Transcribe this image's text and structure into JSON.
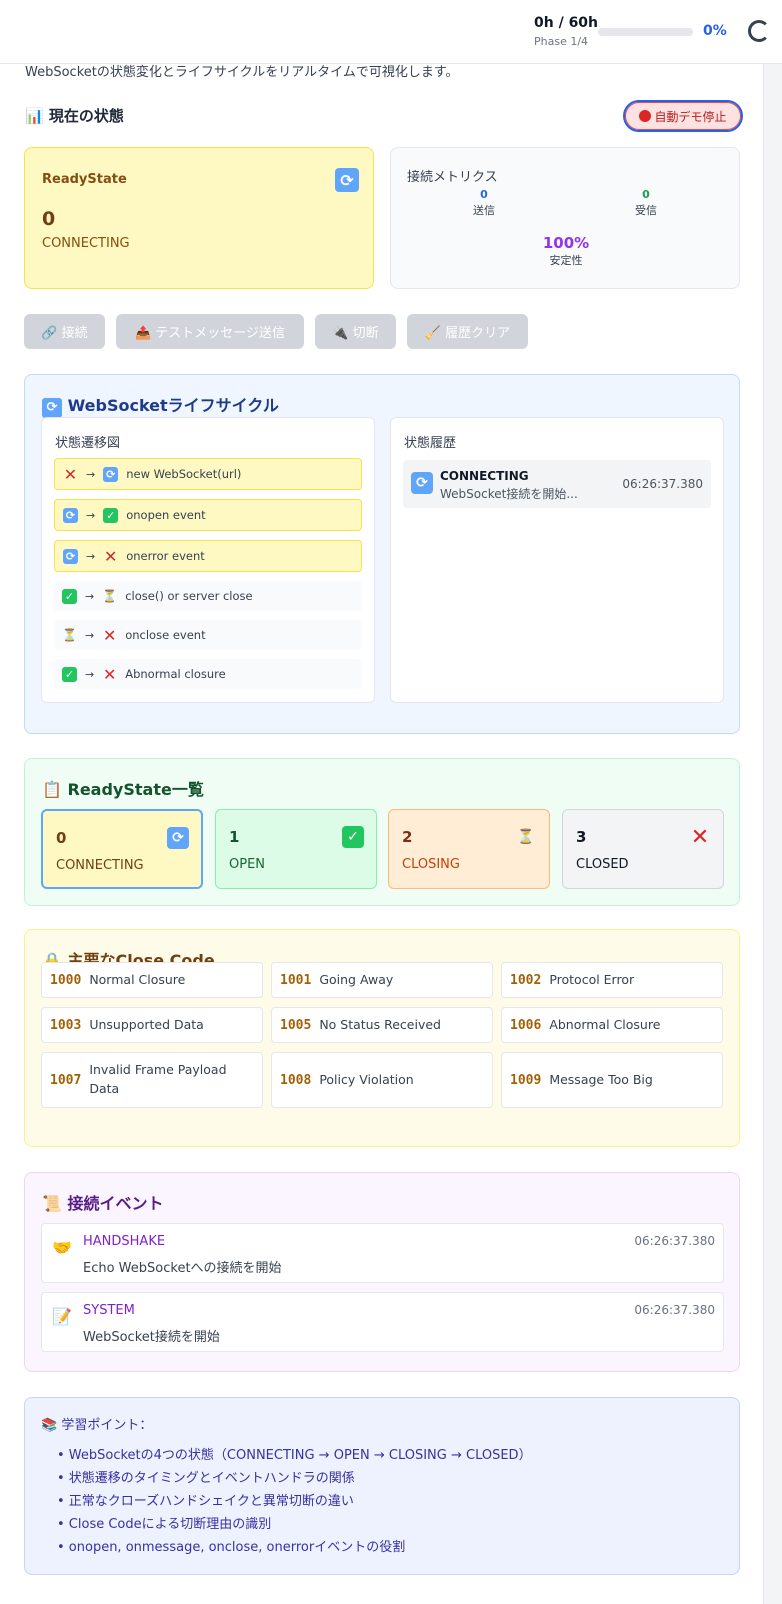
{
  "header": {
    "time": "0h / 60h",
    "phase": "Phase 1/4",
    "progress_percent": 0,
    "progress_label": "0%",
    "github_icon": "github-icon"
  },
  "intro_text": "WebSocketの状態変化とライフサイクルをリアルタイムで可視化します。",
  "current_state": {
    "title_icon": "📊",
    "title": "現在の状態",
    "stop_button": "自動デモ停止",
    "readystate_label": "ReadyState",
    "readystate_value": "0",
    "readystate_name": "CONNECTING",
    "readystate_icon": "sync-icon"
  },
  "metrics": {
    "title": "接続メトリクス",
    "sent_value": "0",
    "sent_label": "送信",
    "received_value": "0",
    "received_label": "受信",
    "stability_value": "100%",
    "stability_label": "安定性"
  },
  "actions": {
    "connect": "🔗 接続",
    "send_test": "📤 テストメッセージ送信",
    "disconnect": "🔌 切断",
    "clear_history": "🧹 履歴クリア"
  },
  "lifecycle": {
    "title": "WebSocketライフサイクル",
    "diagram_title": "状態遷移図",
    "transitions": [
      {
        "from": "x",
        "to": "sync",
        "label": "new WebSocket(url)",
        "highlight": true
      },
      {
        "from": "sync",
        "to": "ok",
        "label": "onopen event",
        "highlight": true
      },
      {
        "from": "sync",
        "to": "x",
        "label": "onerror event",
        "highlight": true
      },
      {
        "from": "ok",
        "to": "hourglass",
        "label": "close() or server close",
        "highlight": false
      },
      {
        "from": "hourglass",
        "to": "x",
        "label": "onclose event",
        "highlight": false
      },
      {
        "from": "ok",
        "to": "x",
        "label": "Abnormal closure",
        "highlight": false
      }
    ],
    "arrow": "→",
    "history_title": "状態履歴",
    "history": [
      {
        "state": "CONNECTING",
        "desc": "WebSocket接続を開始...",
        "time": "06:26:37.380"
      }
    ]
  },
  "readystate_list": {
    "title": "ReadyState一覧",
    "title_icon": "📋",
    "states": [
      {
        "num": "0",
        "name": "CONNECTING",
        "icon": "🔄"
      },
      {
        "num": "1",
        "name": "OPEN",
        "icon": "✓"
      },
      {
        "num": "2",
        "name": "CLOSING",
        "icon": "⏳"
      },
      {
        "num": "3",
        "name": "CLOSED",
        "icon": "✕"
      }
    ]
  },
  "close_codes": {
    "title": "主要なClose Code",
    "title_icon": "🔒",
    "codes": [
      {
        "code": "1000",
        "desc": "Normal Closure"
      },
      {
        "code": "1001",
        "desc": "Going Away"
      },
      {
        "code": "1002",
        "desc": "Protocol Error"
      },
      {
        "code": "1003",
        "desc": "Unsupported Data"
      },
      {
        "code": "1005",
        "desc": "No Status Received"
      },
      {
        "code": "1006",
        "desc": "Abnormal Closure"
      },
      {
        "code": "1007",
        "desc": "Invalid Frame Payload Data"
      },
      {
        "code": "1008",
        "desc": "Policy Violation"
      },
      {
        "code": "1009",
        "desc": "Message Too Big"
      }
    ]
  },
  "events": {
    "title": "接続イベント",
    "title_icon": "📜",
    "items": [
      {
        "icon": "🤝",
        "type": "HANDSHAKE",
        "message": "Echo WebSocketへの接続を開始",
        "time": "06:26:37.380"
      },
      {
        "icon": "📝",
        "type": "SYSTEM",
        "message": "WebSocket接続を開始",
        "time": "06:26:37.380"
      }
    ]
  },
  "learning": {
    "title": "📚 学習ポイント：",
    "points": [
      "• WebSocketの4つの状態（CONNECTING → OPEN → CLOSING → CLOSED）",
      "• 状態遷移のタイミングとイベントハンドラの関係",
      "• 正常なクローズハンドシェイクと異常切断の違い",
      "• Close Codeによる切断理由の識別",
      "• onopen, onmessage, onclose, onerrorイベントの役割"
    ]
  }
}
